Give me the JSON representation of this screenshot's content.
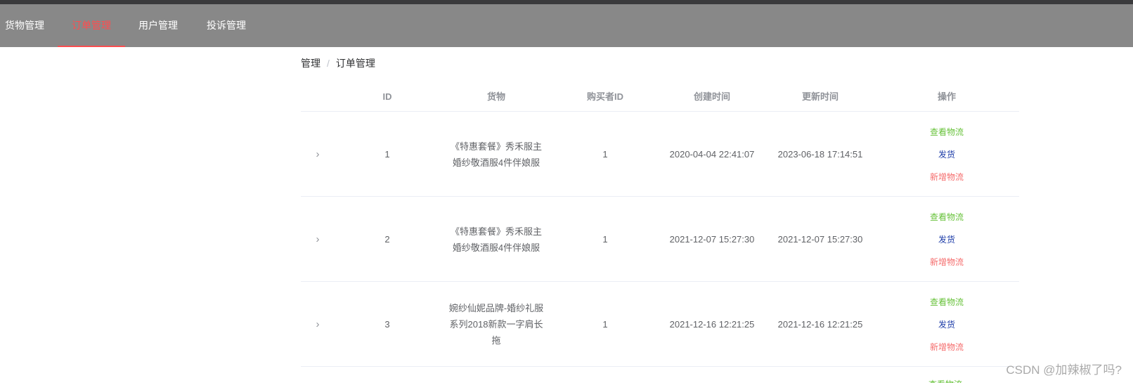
{
  "nav": {
    "items": [
      {
        "label": "货物管理",
        "active": false
      },
      {
        "label": "订单管理",
        "active": true
      },
      {
        "label": "用户管理",
        "active": false
      },
      {
        "label": "投诉管理",
        "active": false
      }
    ]
  },
  "breadcrumb": {
    "root": "管理",
    "separator": "/",
    "current": "订单管理"
  },
  "table": {
    "columns": {
      "id": "ID",
      "goods": "货物",
      "buyer_id": "购买者ID",
      "created": "创建时间",
      "updated": "更新时间",
      "actions": "操作"
    },
    "expand_icon": "›",
    "actions": {
      "logistics": "查看物流",
      "ship": "发货",
      "add_logistics": "新增物流"
    },
    "rows": [
      {
        "id": "1",
        "goods": "《特惠套餐》秀禾服主婚纱敬酒服4件伴娘服",
        "buyer_id": "1",
        "created": "2020-04-04 22:41:07",
        "updated": "2023-06-18 17:14:51"
      },
      {
        "id": "2",
        "goods": "《特惠套餐》秀禾服主婚纱敬酒服4件伴娘服",
        "buyer_id": "1",
        "created": "2021-12-07 15:27:30",
        "updated": "2021-12-07 15:27:30"
      },
      {
        "id": "3",
        "goods": "婉纱仙妮品牌-婚纱礼服系列2018新款一字肩长拖",
        "buyer_id": "1",
        "created": "2021-12-16 12:21:25",
        "updated": "2021-12-16 12:21:25"
      }
    ]
  },
  "watermark": "CSDN @加辣椒了吗?",
  "colors": {
    "nav_bg": "#888888",
    "nav_active": "#ff4d4f",
    "op_logistics": "#67c23a",
    "op_ship": "#1d3ca8",
    "op_add": "#f56c6c"
  }
}
